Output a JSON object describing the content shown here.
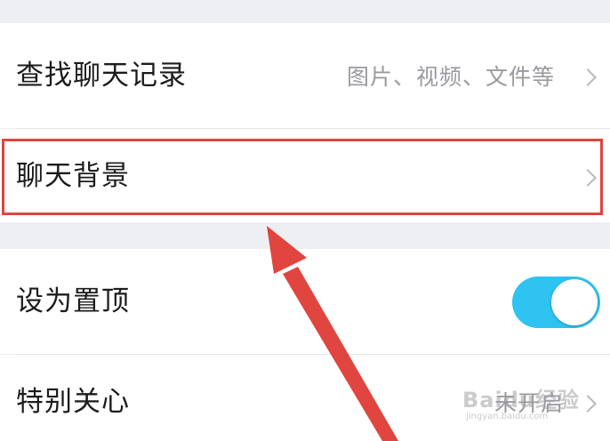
{
  "rows": {
    "search_history": {
      "label": "查找聊天记录",
      "value": "图片、视频、文件等"
    },
    "chat_background": {
      "label": "聊天背景"
    },
    "pin_to_top": {
      "label": "设为置顶",
      "toggle_on": true
    },
    "special_care": {
      "label": "特别关心",
      "value": "未开启"
    }
  },
  "watermark": {
    "text": "Baidu经验",
    "url": "jingyan.baidu.com"
  },
  "colors": {
    "highlight": "#e0453f",
    "toggle_on": "#2ec3f0",
    "background": "#eeeff3"
  }
}
